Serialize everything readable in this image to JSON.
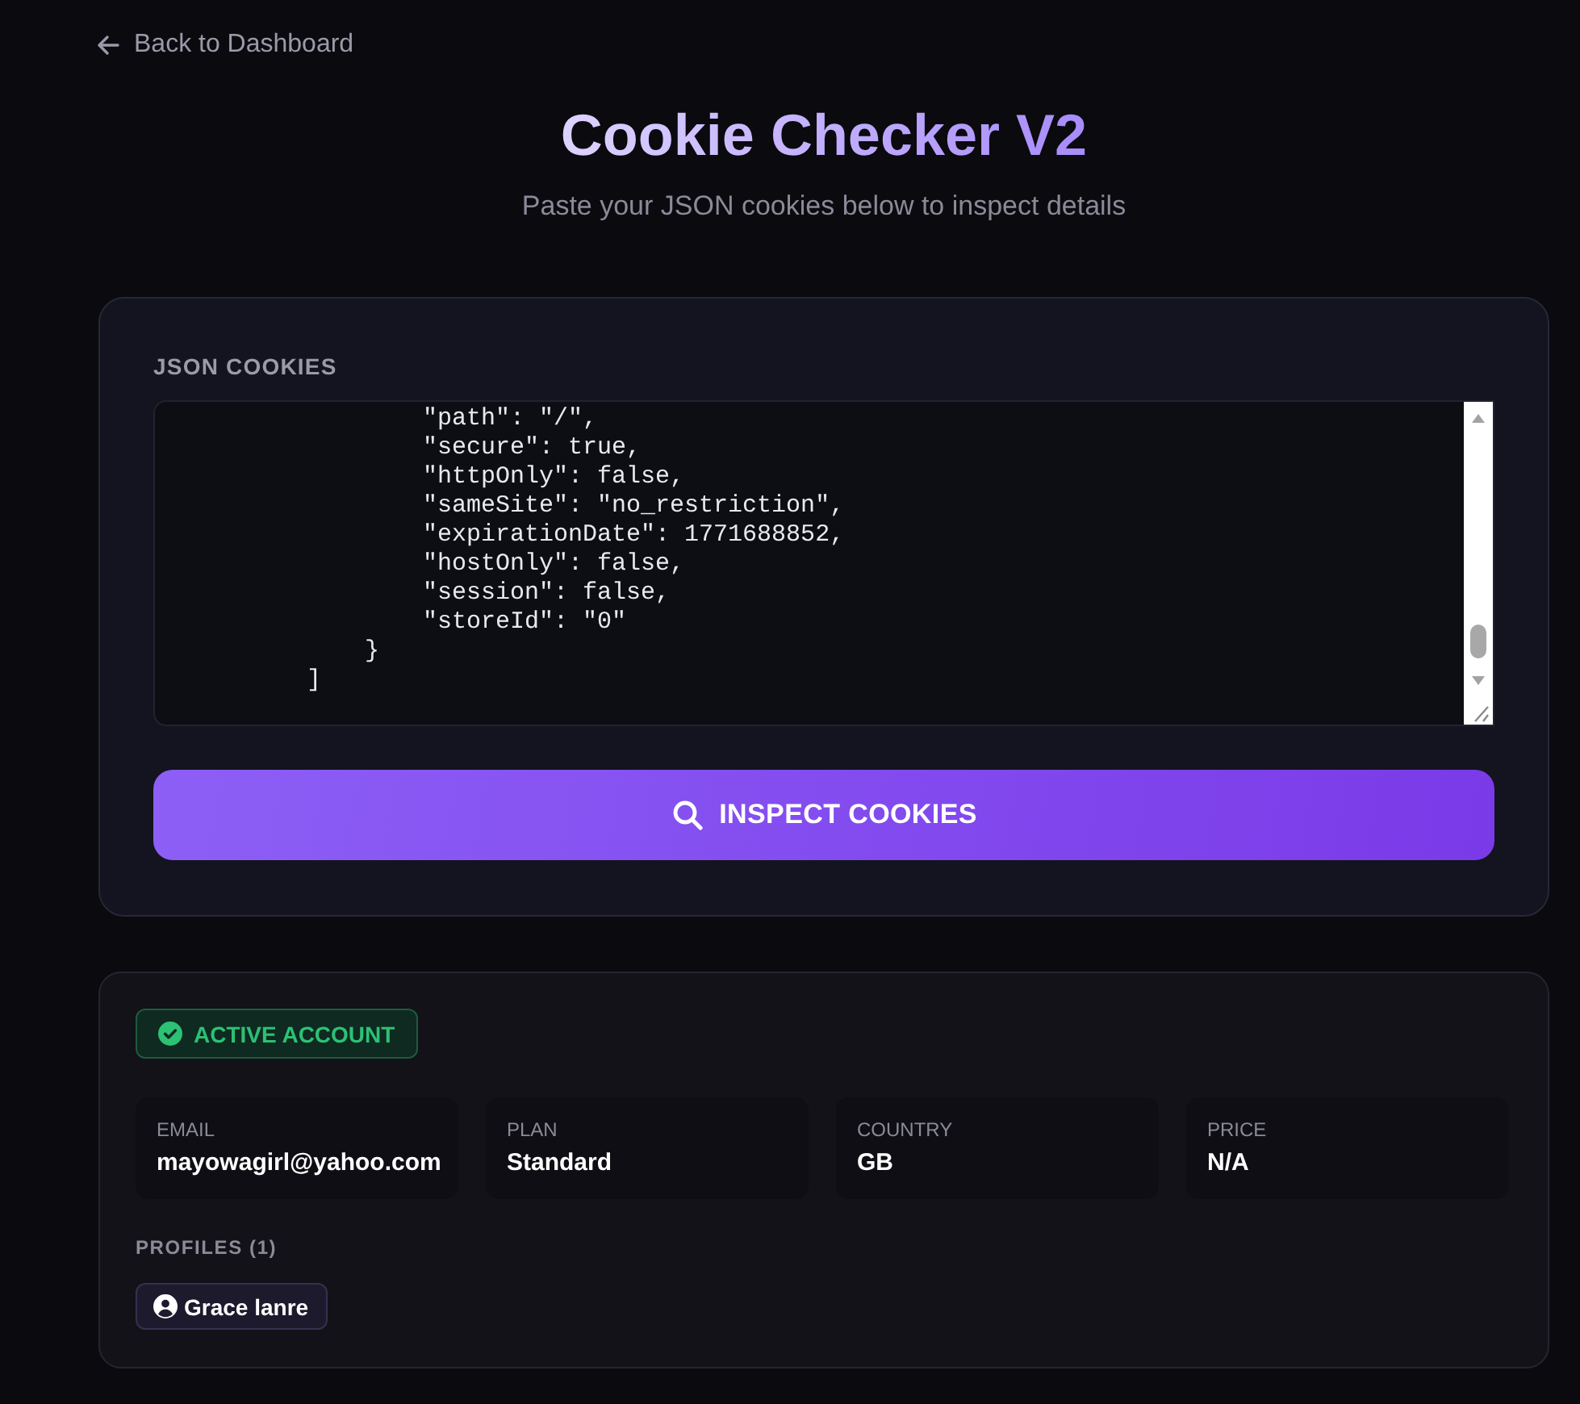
{
  "back_link": {
    "label": "Back to Dashboard"
  },
  "header": {
    "title": "Cookie Checker V2",
    "subtitle": "Paste your JSON cookies below to inspect details"
  },
  "input_card": {
    "label": "JSON COOKIES",
    "value": "                \"path\": \"/\",\n                \"secure\": true,\n                \"httpOnly\": false,\n                \"sameSite\": \"no_restriction\",\n                \"expirationDate\": 1771688852,\n                \"hostOnly\": false,\n                \"session\": false,\n                \"storeId\": \"0\"\n            }\n        ]",
    "button": "INSPECT COOKIES"
  },
  "result_card": {
    "status": {
      "label": "ACTIVE ACCOUNT",
      "active": true
    },
    "fields": [
      {
        "label": "EMAIL",
        "value": "mayowagirl@yahoo.com"
      },
      {
        "label": "PLAN",
        "value": "Standard"
      },
      {
        "label": "COUNTRY",
        "value": "GB"
      },
      {
        "label": "PRICE",
        "value": "N/A"
      }
    ],
    "profiles": {
      "label": "PROFILES (1)",
      "items": [
        {
          "name": "Grace lanre"
        }
      ]
    }
  }
}
